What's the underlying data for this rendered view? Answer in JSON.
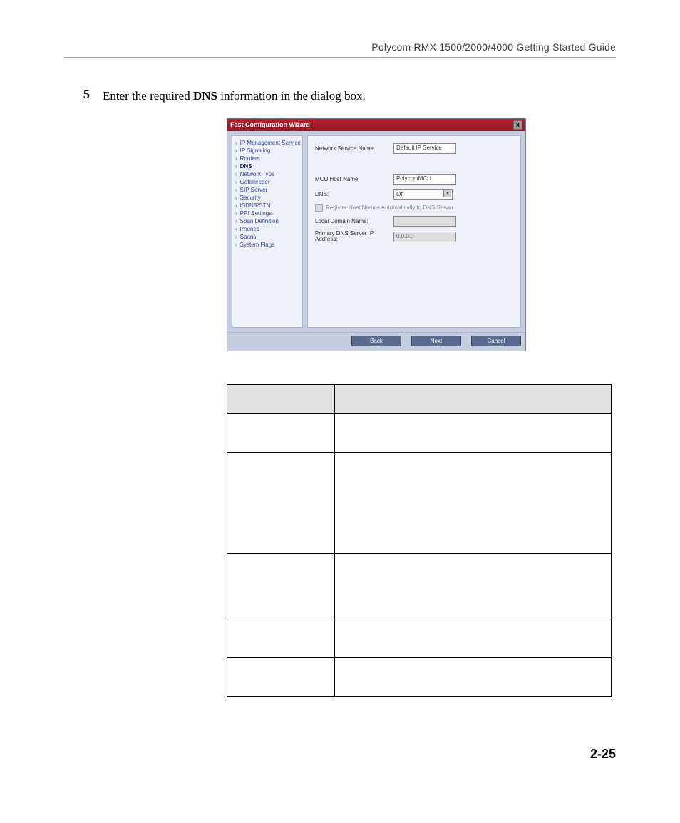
{
  "header": {
    "running_head": "Polycom RMX 1500/2000/4000 Getting Started Guide"
  },
  "step": {
    "number": "5",
    "text_pre": "Enter the required ",
    "text_bold": "DNS",
    "text_post": " information in the dialog box."
  },
  "dialog": {
    "title": "Fast Configuration Wizard",
    "sidebar": [
      {
        "label": "IP Management Service",
        "selected": false
      },
      {
        "label": "IP Signaling",
        "selected": false
      },
      {
        "label": "Routers",
        "selected": false
      },
      {
        "label": "DNS",
        "selected": true
      },
      {
        "label": "Network Type",
        "selected": false
      },
      {
        "label": "Gatekeeper",
        "selected": false
      },
      {
        "label": "SIP Server",
        "selected": false
      },
      {
        "label": "Security",
        "selected": false
      },
      {
        "label": "ISDN/PSTN",
        "selected": false
      },
      {
        "label": "PRI Settings",
        "selected": false
      },
      {
        "label": "Span Definition",
        "selected": false
      },
      {
        "label": "Phones",
        "selected": false
      },
      {
        "label": "Spans",
        "selected": false
      },
      {
        "label": "System Flags",
        "selected": false
      }
    ],
    "fields": {
      "network_service_label": "Network Service Name:",
      "network_service_value": "Default IP Service",
      "mcu_host_label": "MCU Host Name:",
      "mcu_host_value": "PolycomMCU",
      "dns_label": "DNS:",
      "dns_value": "Off",
      "register_checkbox_label": "Register Host Names Automatically to DNS Server",
      "local_domain_label": "Local Domain Name:",
      "local_domain_value": "",
      "primary_dns_label": "Primary DNS Server IP Address:",
      "primary_dns_value": "0.0.0.0"
    },
    "buttons": {
      "back": "Back",
      "next": "Next",
      "cancel": "Cancel"
    }
  },
  "page_number": "2-25"
}
